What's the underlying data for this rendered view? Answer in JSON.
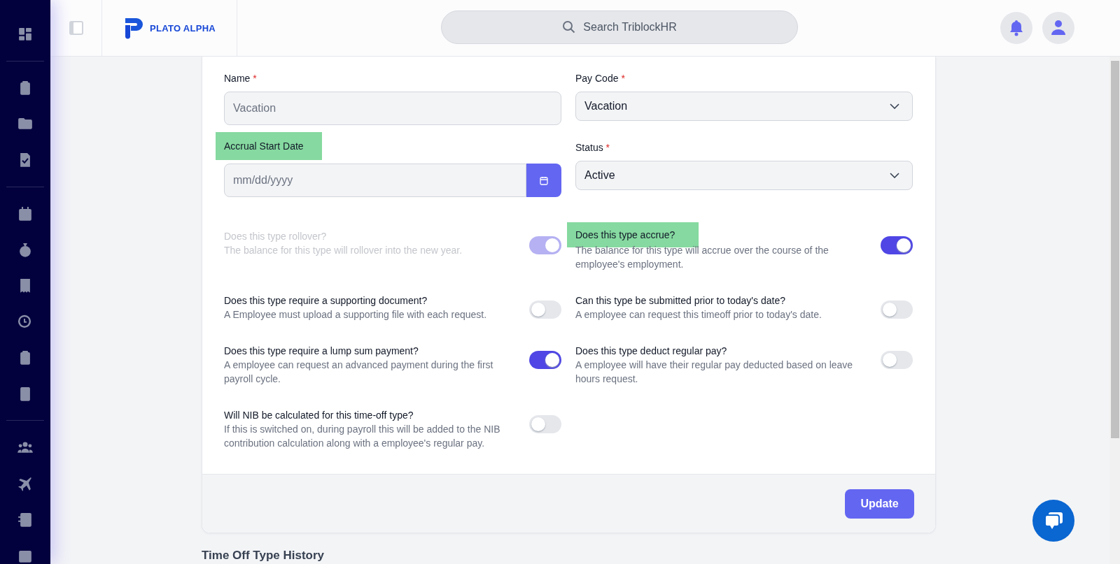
{
  "header": {
    "logo": "PLATO ALPHA",
    "search": {
      "placeholder": "Search TriblockHR"
    }
  },
  "form": {
    "fields": [
      {
        "kind": "text",
        "label": "Name",
        "required_mark": "*",
        "placeholder": "Vacation",
        "highlighted": false
      },
      {
        "kind": "select",
        "label": "Pay Code",
        "required_mark": "*",
        "value": "Vacation",
        "highlighted": false
      },
      {
        "kind": "date",
        "label": "Accrual Start Date",
        "placeholder": "mm/dd/yyyy",
        "highlighted": true
      },
      {
        "kind": "select",
        "label": "Status",
        "required_mark": "*",
        "value": "Active",
        "highlighted": false
      }
    ],
    "toggles": [
      {
        "title": "Does this type rollover?",
        "description": "The balance for this type will rollover into the new year.",
        "on": true,
        "disabled": true,
        "highlighted": false
      },
      {
        "title": "Does this type accrue?",
        "description": "The balance for this type will accrue over the course of the employee's employment.",
        "on": true,
        "disabled": false,
        "highlighted": true
      },
      {
        "title": "Does this type require a supporting document?",
        "description": "A Employee must upload a supporting file with each request.",
        "on": false,
        "disabled": false,
        "highlighted": false
      },
      {
        "title": "Can this type be submitted prior to today's date?",
        "description": "A employee can request this timeoff prior to today's date.",
        "on": false,
        "disabled": false,
        "highlighted": false
      },
      {
        "title": "Does this type require a lump sum payment?",
        "description": "A employee can request an advanced payment during the first payroll cycle.",
        "on": true,
        "disabled": false,
        "highlighted": false
      },
      {
        "title": "Does this type deduct regular pay?",
        "description": "A employee will have their regular pay deducted based on leave hours request.",
        "on": false,
        "disabled": false,
        "highlighted": false
      },
      {
        "title": "Will NIB be calculated for this time-off type?",
        "description": "If this is switched on, during payroll this will be added to the NIB contribution calculation along with a employee's regular pay.",
        "on": false,
        "disabled": false,
        "highlighted": false
      }
    ],
    "submit": "Update"
  },
  "section_heading": "Time Off Type History"
}
